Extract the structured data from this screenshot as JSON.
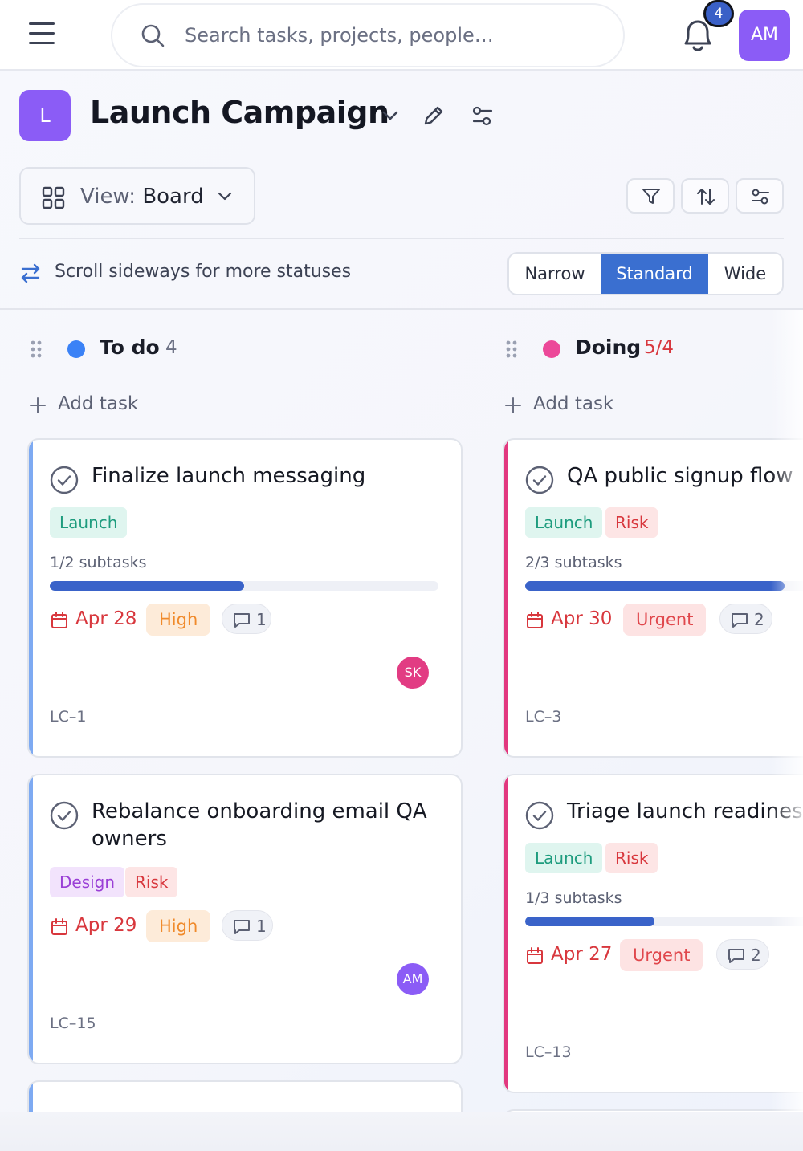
{
  "topbar": {
    "search_placeholder": "Search tasks, projects, people…",
    "notification_count": "4",
    "user_initials": "AM"
  },
  "project": {
    "icon_letter": "L",
    "title": "Launch Campaign"
  },
  "view": {
    "label": "View:",
    "value": "Board"
  },
  "hint": "Scroll sideways for more statuses",
  "density": {
    "narrow": "Narrow",
    "standard": "Standard",
    "wide": "Wide",
    "selected": "Standard"
  },
  "columns": [
    {
      "title": "To do",
      "count": "4",
      "dot_color": "#3b82f6",
      "add_task": "Add task",
      "cards": [
        {
          "title_lines": [
            "Finalize launch messaging"
          ],
          "tags": [
            "Launch"
          ],
          "subtasks": "1/2 subtasks",
          "progress": 0.5,
          "due": "Apr 28",
          "priority": "High",
          "comments": "1",
          "assignee": "SK",
          "key": "LC–1"
        },
        {
          "title_lines": [
            "Rebalance onboarding email QA",
            "owners"
          ],
          "tags": [
            "Design",
            "Risk"
          ],
          "due": "Apr 29",
          "priority": "High",
          "comments": "1",
          "assignee": "AM",
          "key": "LC–15"
        }
      ]
    },
    {
      "title": "Doing",
      "count": "5/4",
      "dot_color": "#ec4899",
      "add_task": "Add task",
      "cards": [
        {
          "title_lines": [
            "QA public signup flow"
          ],
          "tags": [
            "Launch",
            "Risk"
          ],
          "subtasks": "2/3 subtasks",
          "progress": 0.667,
          "due": "Apr 30",
          "priority": "Urgent",
          "comments": "2",
          "key": "LC–3"
        },
        {
          "title_lines": [
            "Triage launch readiness"
          ],
          "tags": [
            "Launch",
            "Risk"
          ],
          "subtasks": "1/3 subtasks",
          "progress": 0.333,
          "due": "Apr 27",
          "priority": "Urgent",
          "comments": "2",
          "key": "LC–13"
        }
      ]
    }
  ],
  "colors": {
    "accent": "#3a6fd0",
    "todo_bar": "#7eaaf2",
    "doing_bar": "#e2387f",
    "avatar_purple": "#8b5cf6",
    "avatar_pink": "#e23c83"
  }
}
